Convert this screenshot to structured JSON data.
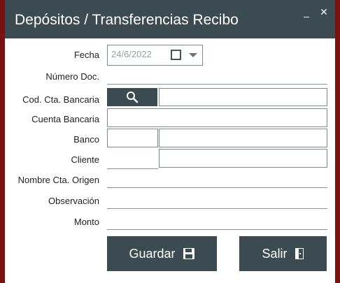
{
  "window": {
    "title": "Depósitos / Transferencias Recibo",
    "minimize_glyph": "_",
    "close_glyph": "✕"
  },
  "form": {
    "fecha_label": "Fecha",
    "fecha_value": "24/6/2022",
    "numero_doc_label": "Número Doc.",
    "cod_cta_label": "Cod. Cta. Bancaria",
    "cuenta_label": "Cuenta Bancaria",
    "banco_label": "Banco",
    "cliente_label": "Cliente",
    "nombre_cta_origen_label": "Nombre Cta. Origen",
    "observacion_label": "Observación",
    "monto_label": "Monto"
  },
  "buttons": {
    "guardar_label": "Guardar",
    "salir_label": "Salir"
  },
  "icons": {
    "search": "search-icon",
    "save": "save-icon",
    "exit": "exit-door-icon",
    "dropdown": "chevron-down-icon",
    "checkbox": "checkbox-icon"
  },
  "colors": {
    "titlebar": "#3c4a52",
    "button": "#3c4a52",
    "background_accent": "#7a1010"
  }
}
